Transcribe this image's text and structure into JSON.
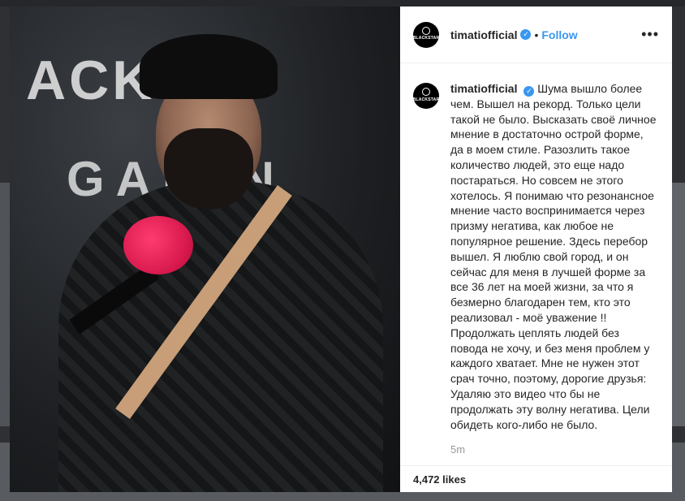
{
  "post": {
    "username": "timatiofficial",
    "avatar_text": "BLACKSTAR",
    "separator": "•",
    "follow_label": "Follow",
    "more_icon": "•••",
    "photo_banner_line1": "ACK S",
    "photo_banner_line2": "GAMIN",
    "caption": "Шума вышло более чем. Вышел на рекорд. Только цели такой не было. Высказать своё личное мнение в достаточно острой форме, да в моем стиле. Разозлить такое количество людей, это еще надо постараться. Но совсем не этого хотелось. Я понимаю что резонансное мнение часто воспринимается через призму негатива, как любое не популярное решение. Здесь перебор вышел. Я люблю свой город, и он сейчас для меня в лучшей форме за все 36 лет на моей жизни, за что я безмерно благодарен тем, кто это реализовал - моё уважение !! Продолжать цеплять людей без повода не хочу, и без меня проблем у каждого хватает. Мне не нужен этот срач точно, поэтому, дорогие друзья: Удаляю это видео что бы не продолжать эту волну негатива. Цели обидеть кого-либо не было.",
    "timestamp": "5m",
    "likes": "4,472 likes"
  },
  "colors": {
    "accent": "#3897f0",
    "text": "#262626",
    "muted": "#999999",
    "mic": "#d4174b"
  }
}
